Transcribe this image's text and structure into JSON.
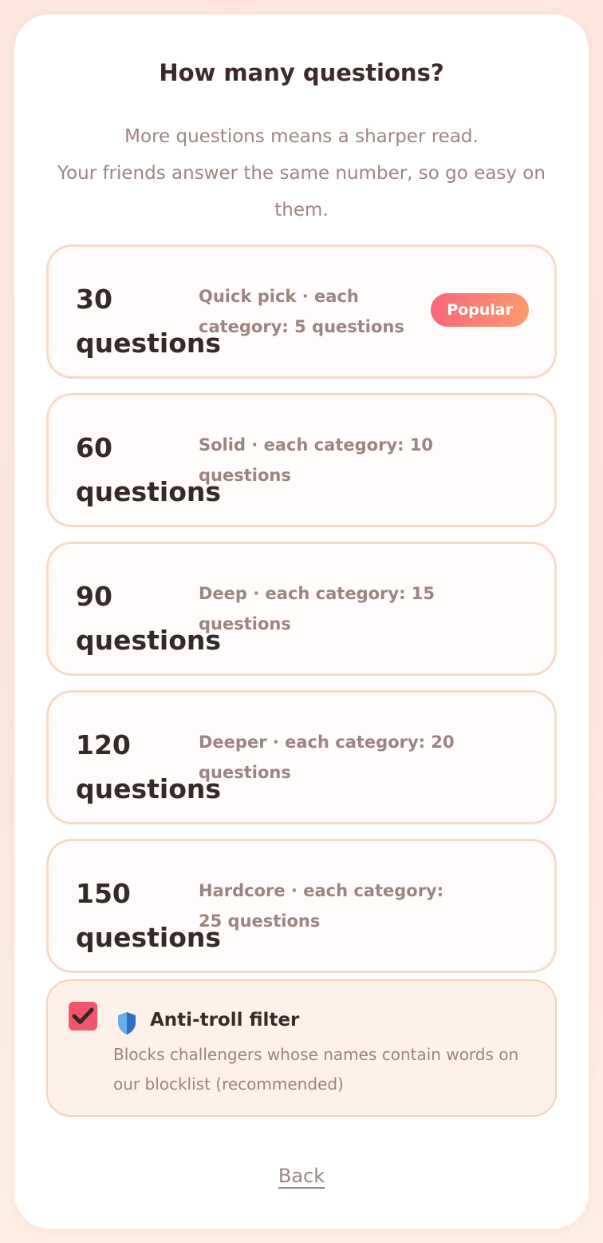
{
  "header": {
    "title": "How many questions?",
    "subtitle_line1": "More questions means a sharper read.",
    "subtitle_line2": "Your friends answer the same number, so go easy on them."
  },
  "options": [
    {
      "count": "30",
      "unit": "questions",
      "description": "Quick pick · each category: 5 questions",
      "badge": "Popular"
    },
    {
      "count": "60",
      "unit": "questions",
      "description": "Solid · each category: 10 questions"
    },
    {
      "count": "90",
      "unit": "questions",
      "description": "Deep · each category: 15 questions"
    },
    {
      "count": "120",
      "unit": "questions",
      "description": "Deeper · each category: 20 questions"
    },
    {
      "count": "150",
      "unit": "questions",
      "description": "Hardcore · each category: 25 questions"
    }
  ],
  "filter": {
    "title": "Anti-troll filter",
    "description": "Blocks challengers whose names contain words on our blocklist (recommended)",
    "checked": true,
    "icon": "shield-icon"
  },
  "footer": {
    "back_label": "Back"
  },
  "colors": {
    "accent": "#f2566f",
    "badge_start": "#f7677b",
    "badge_end": "#fd9a6e",
    "option_border": "#fbd9c9",
    "filter_background": "#fdf1ea"
  }
}
